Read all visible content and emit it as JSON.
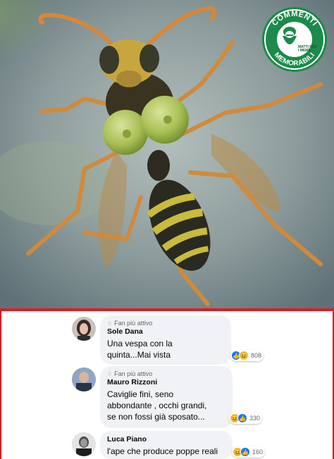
{
  "badge": {
    "top_text": "COMMENTI",
    "bottom_text": "MEMORABILI",
    "small_text": "MATTI PER I MEME",
    "brand_color": "#1b8a4a"
  },
  "photo": {
    "subject_icon": "wasp-illustration"
  },
  "comments": [
    {
      "fan_label": "Fan più attivo",
      "author": "Sole Dana",
      "text": "Una vespa con la\nquinta...Mai vista",
      "reaction_count": "808"
    },
    {
      "fan_label": "Fan più attivo",
      "author": "Mauro Rizzoni",
      "text": "Caviglie fini, seno\nabbondante , occhi grandi,\nse non fossi già sposato...",
      "reaction_count": "330"
    },
    {
      "author": "Luca Piano",
      "text": "l'ape che produce poppe reali",
      "reaction_count": "160"
    }
  ],
  "colors": {
    "separator": "#d42027",
    "like": "#1877f2",
    "haha": "#f7b928",
    "bubble": "#f0f2f5"
  }
}
